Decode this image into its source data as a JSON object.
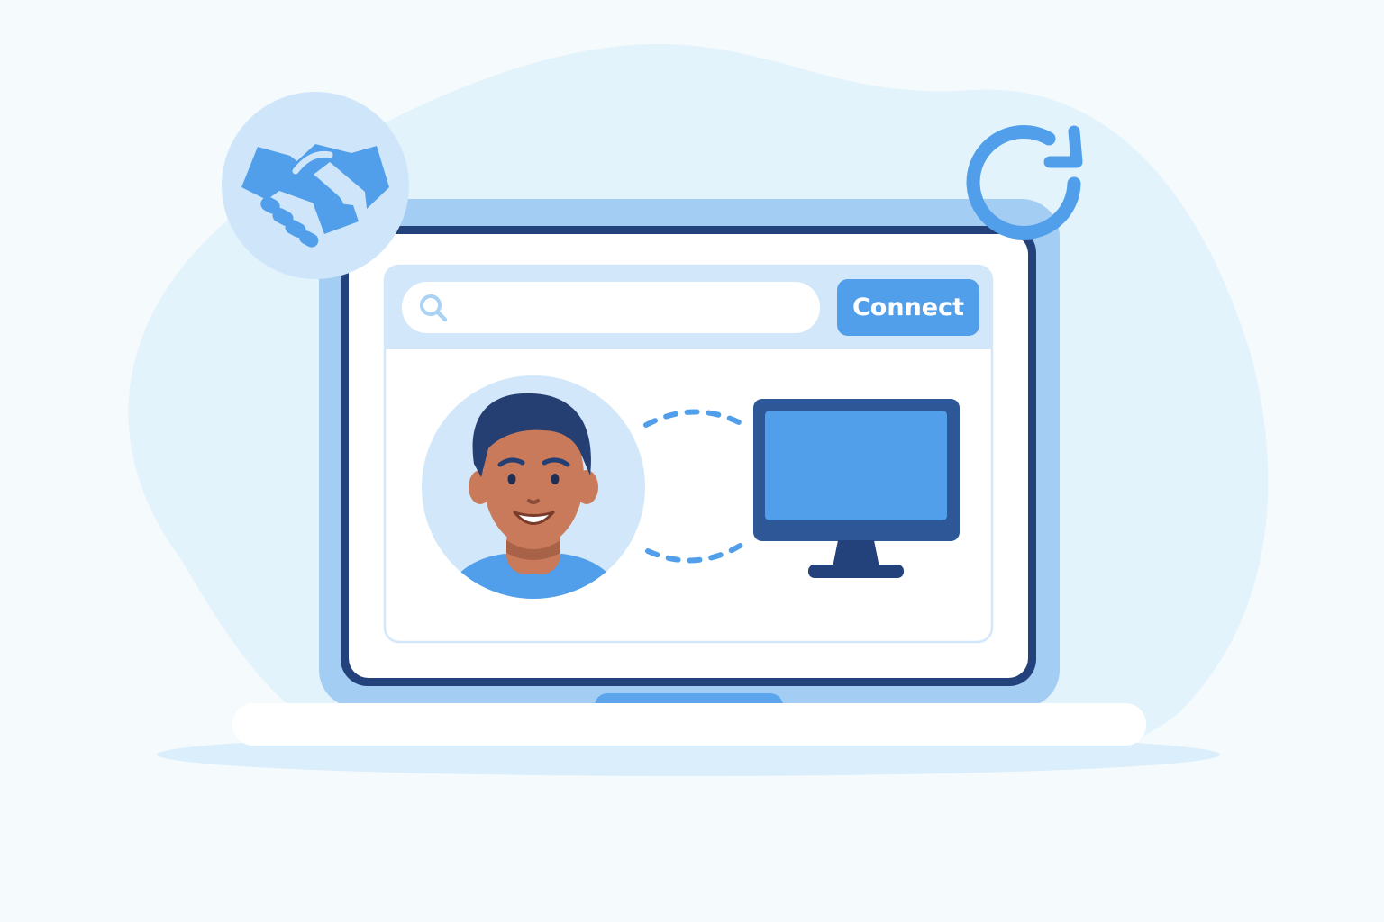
{
  "search": {
    "value": "",
    "placeholder": ""
  },
  "toolbar": {
    "connect_label": "Connect"
  },
  "icons": {
    "badge_left": "handshake-icon",
    "badge_right": "refresh-icon",
    "search": "search-icon",
    "avatar": "user-avatar",
    "device": "desktop-monitor-icon",
    "link": "dotted-connection-arc"
  },
  "colors": {
    "background": "#f5fafd",
    "blob": "#e3f3fc",
    "laptop_frame": "#a4cdf4",
    "screen_border": "#23417a",
    "panel_header": "#d2e7fa",
    "accent": "#519fea",
    "monitor_frame": "#2e5797",
    "monitor_screen": "#519fea",
    "skin": "#c97a5a",
    "hair": "#253f72"
  }
}
